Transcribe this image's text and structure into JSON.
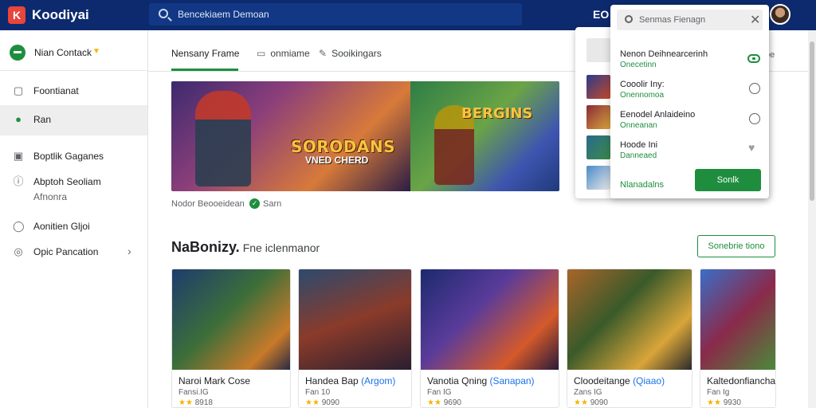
{
  "app": {
    "title": "Koodiyai",
    "logo_glyph": "K"
  },
  "search": {
    "placeholder": "Bencekiaem Demoan"
  },
  "topbar": {
    "right_label": "EO"
  },
  "sidebar": {
    "account": {
      "label": "Nian Contack"
    },
    "items": [
      {
        "label": "Foontianat",
        "icon": "grid-icon",
        "glyph": "▢"
      },
      {
        "label": "Ran",
        "icon": "person-icon",
        "glyph": "●"
      },
      {
        "label": "Boptlik Gaganes",
        "icon": "document-icon",
        "glyph": "▣"
      },
      {
        "label": "Abptoh Seoliam",
        "sub": "Afnonra",
        "icon": "info-icon",
        "glyph": "ⓘ"
      },
      {
        "label": "Aonitien Gljoi",
        "icon": "chat-icon",
        "glyph": "◯"
      },
      {
        "label": "Opic Pancation",
        "icon": "circle-icon",
        "glyph": "◎"
      }
    ]
  },
  "tabs": [
    {
      "label": "Nensany Frame"
    },
    {
      "label": "onmiame",
      "icon": "window-icon",
      "glyph": "▭"
    },
    {
      "label": "Sooikingars",
      "icon": "pen-icon",
      "glyph": "✎"
    }
  ],
  "banner": {
    "title": "SORODANS",
    "subtitle": "VNED CHERD",
    "title2": "BERGINS"
  },
  "under_banner": {
    "left": "Nodor Beooeidean",
    "right": "Sarn"
  },
  "section": {
    "title": "NaBonizy.",
    "title_rest": "Fne iclenmanor",
    "see_more": "Sonebrie tiono"
  },
  "cards": [
    {
      "title": "Naroi Mark Cose",
      "accent": "",
      "meta": "Fansi.IG",
      "rating": "8918"
    },
    {
      "title": "Handea Bap ",
      "accent": "(Argom)",
      "meta": "Fan 10",
      "rating": "9090"
    },
    {
      "title": "Vanotia Qning ",
      "accent": "(Sanapan)",
      "meta": "Fan IG",
      "rating": "9690"
    },
    {
      "title": "Cloodeitange ",
      "accent": "(Qiaao)",
      "meta": "Zans IG",
      "rating": "9090"
    },
    {
      "title": "Kaltedonfianchan",
      "accent": "",
      "meta": "Fan Ig",
      "rating": "9930"
    }
  ],
  "popup": {
    "search_placeholder": "Senmas Fienagn",
    "rows": [
      {
        "title": "Nenon Deihnearcerinh",
        "sub": "Onecetinn",
        "control": "toggle"
      },
      {
        "title": "Cooolir Iny:",
        "sub": "Onennomoa",
        "control": "radio"
      },
      {
        "title": "Eenodel Anlaideino",
        "sub": "Onneanan",
        "control": "radio"
      },
      {
        "title": "Hoode Ini",
        "sub": "Danneaed",
        "control": "heart"
      }
    ],
    "link": "Nlanadalns",
    "button": "Sonlk",
    "side_text": "oe"
  },
  "colors": {
    "topbar": "#0d2a6e",
    "accent_green": "#1e8e3e",
    "logo_red": "#e8453c",
    "star": "#f4b400",
    "link_blue": "#1a73e8"
  }
}
